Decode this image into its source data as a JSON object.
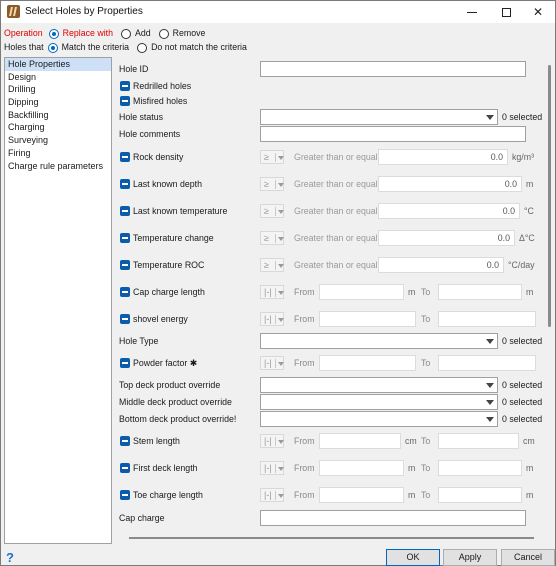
{
  "window": {
    "title": "Select Holes by Properties"
  },
  "operation": {
    "label": "Operation",
    "options": [
      "Replace with",
      "Add",
      "Remove"
    ],
    "selected": "Replace with"
  },
  "holes_that": {
    "label": "Holes that",
    "options": [
      "Match the criteria",
      "Do not match the criteria"
    ],
    "selected": "Match the criteria"
  },
  "sidebar": {
    "items": [
      {
        "label": "Hole Properties",
        "selected": true
      },
      {
        "label": "Design"
      },
      {
        "label": "Drilling"
      },
      {
        "label": "Dipping"
      },
      {
        "label": "Backfilling"
      },
      {
        "label": "Charging"
      },
      {
        "label": "Surveying"
      },
      {
        "label": "Firing"
      },
      {
        "label": "Charge rule parameters"
      }
    ]
  },
  "fields": {
    "hole_id": {
      "label": "Hole ID"
    },
    "redrilled": {
      "label": "Redrilled holes"
    },
    "misfired": {
      "label": "Misfired holes"
    },
    "hole_status": {
      "label": "Hole status",
      "selected": "0 selected"
    },
    "hole_comments": {
      "label": "Hole comments"
    },
    "rock_density": {
      "label": "Rock density",
      "op_symbol": "≥",
      "op_text": "Greater than or equal",
      "value": "0.0",
      "unit": "kg/m³"
    },
    "last_known_depth": {
      "label": "Last known depth",
      "op_symbol": "≥",
      "op_text": "Greater than or equal",
      "value": "0.0",
      "unit": "m"
    },
    "last_known_temperature": {
      "label": "Last known temperature",
      "op_symbol": "≥",
      "op_text": "Greater than or equal",
      "value": "0.0",
      "unit": "°C"
    },
    "temperature_change": {
      "label": "Temperature change",
      "op_symbol": "≥",
      "op_text": "Greater than or equal",
      "value": "0.0",
      "unit": "Δ°C"
    },
    "temperature_roc": {
      "label": "Temperature ROC",
      "op_symbol": "≥",
      "op_text": "Greater than or equal",
      "value": "0.0",
      "unit": "°C/day"
    },
    "cap_charge_length": {
      "label": "Cap charge length",
      "op_symbol": "|-|",
      "from": "From",
      "to": "To",
      "unit": "m"
    },
    "shovel_energy": {
      "label": "shovel energy",
      "op_symbol": "|-|",
      "from": "From",
      "to": "To"
    },
    "hole_type": {
      "label": "Hole Type",
      "selected": "0 selected"
    },
    "powder_factor": {
      "label": "Powder factor",
      "star": "✱",
      "op_symbol": "|-|",
      "from": "From",
      "to": "To"
    },
    "top_deck": {
      "label": "Top deck product override",
      "selected": "0 selected"
    },
    "middle_deck": {
      "label": "Middle deck product override",
      "selected": "0 selected"
    },
    "bottom_deck": {
      "label": "Bottom deck product override!",
      "selected": "0 selected"
    },
    "stem_length": {
      "label": "Stem length",
      "op_symbol": "|-|",
      "from": "From",
      "to": "To",
      "unit": "cm"
    },
    "first_deck_length": {
      "label": "First deck length",
      "op_symbol": "|-|",
      "from": "From",
      "to": "To",
      "unit": "m"
    },
    "toe_charge_length": {
      "label": "Toe charge length",
      "op_symbol": "|-|",
      "from": "From",
      "to": "To",
      "unit": "m"
    },
    "cap_charge": {
      "label": "Cap charge"
    }
  },
  "buttons": {
    "ok": "OK",
    "apply": "Apply",
    "cancel": "Cancel",
    "help": "?"
  },
  "colors": {
    "accent": "#0067c0",
    "operation_label": "#e00000",
    "checkbox": "#0b5cad",
    "selected_nav": "#cde0f6"
  }
}
